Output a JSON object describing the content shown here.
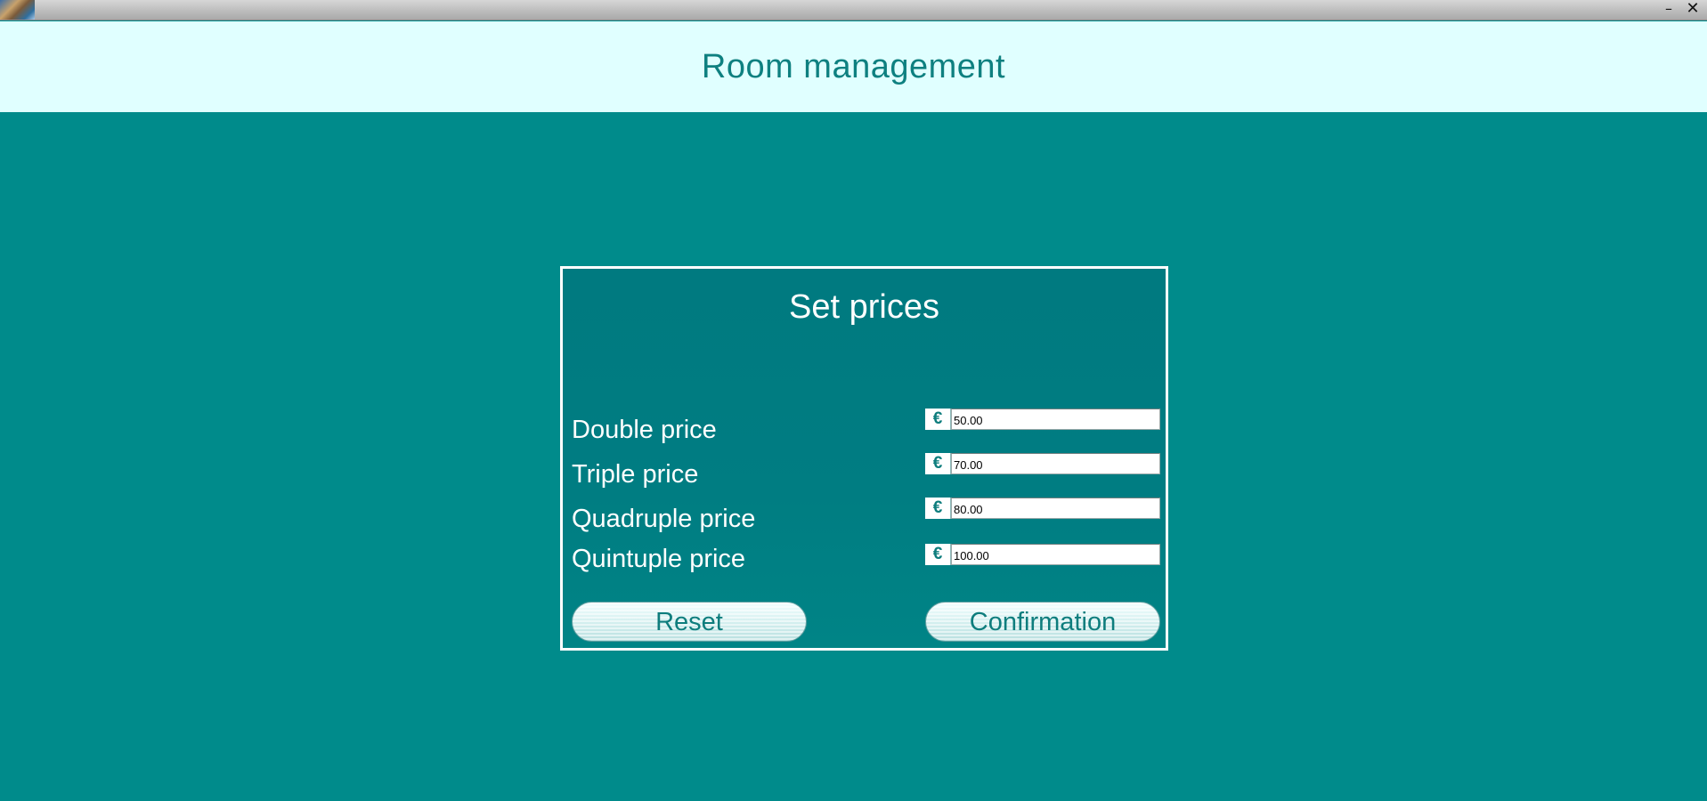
{
  "window": {
    "minimize_label": "–",
    "close_label": "✕",
    "app_icon": "hotel-photo-icon"
  },
  "header": {
    "title": "Room management"
  },
  "panel": {
    "title": "Set prices",
    "currency_symbol": "€",
    "rows": [
      {
        "label": "Double price",
        "value": "50.00"
      },
      {
        "label": "Triple price",
        "value": "70.00"
      },
      {
        "label": "Quadruple price",
        "value": "80.00"
      },
      {
        "label": "Quintuple price",
        "value": "100.00"
      }
    ],
    "reset_label": "Reset",
    "confirm_label": "Confirmation"
  },
  "colors": {
    "header_background": "#e0ffff",
    "main_background": "#008b8b",
    "title_text": "#0e8080",
    "panel_border": "#ffffff"
  }
}
